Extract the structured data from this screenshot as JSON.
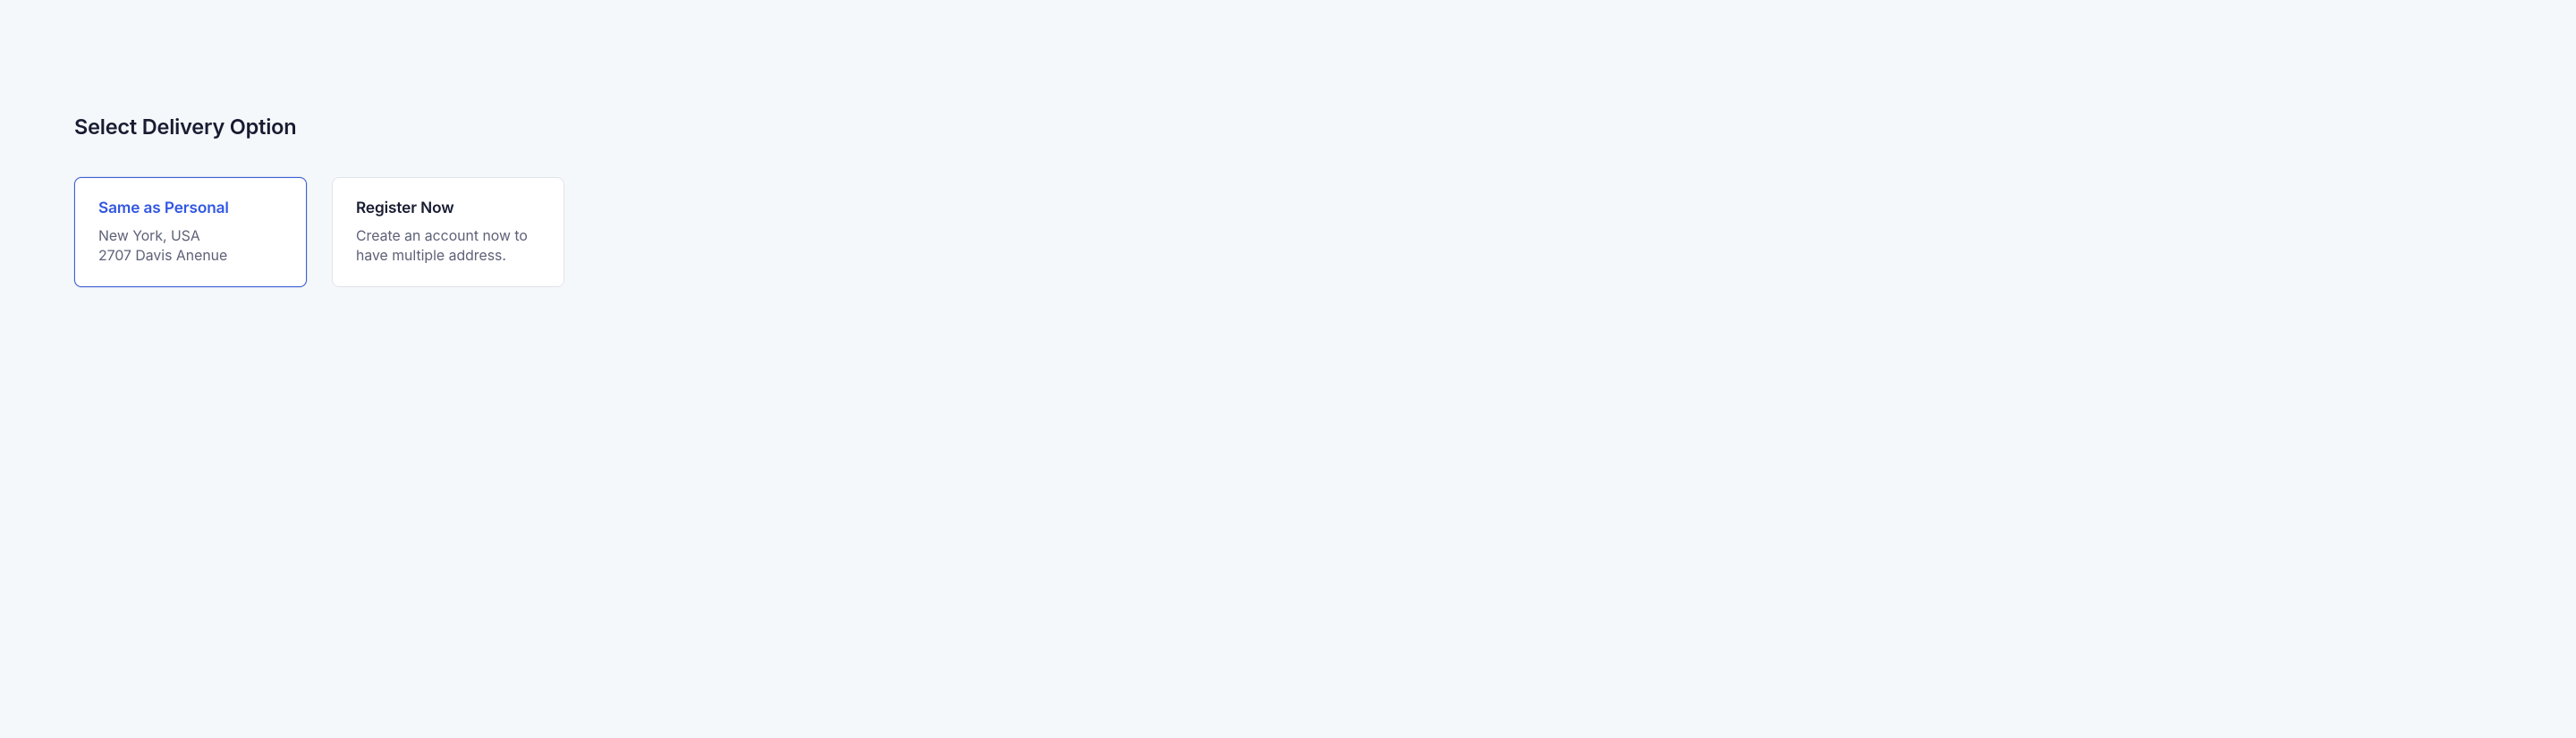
{
  "section": {
    "title": "Select Delivery Option"
  },
  "cards": [
    {
      "title": "Same as Personal",
      "line1": "New York, USA",
      "line2": "2707 Davis Anenue"
    },
    {
      "title": "Register Now",
      "line1": "Create an account now to",
      "line2": "have multiple address."
    }
  ]
}
